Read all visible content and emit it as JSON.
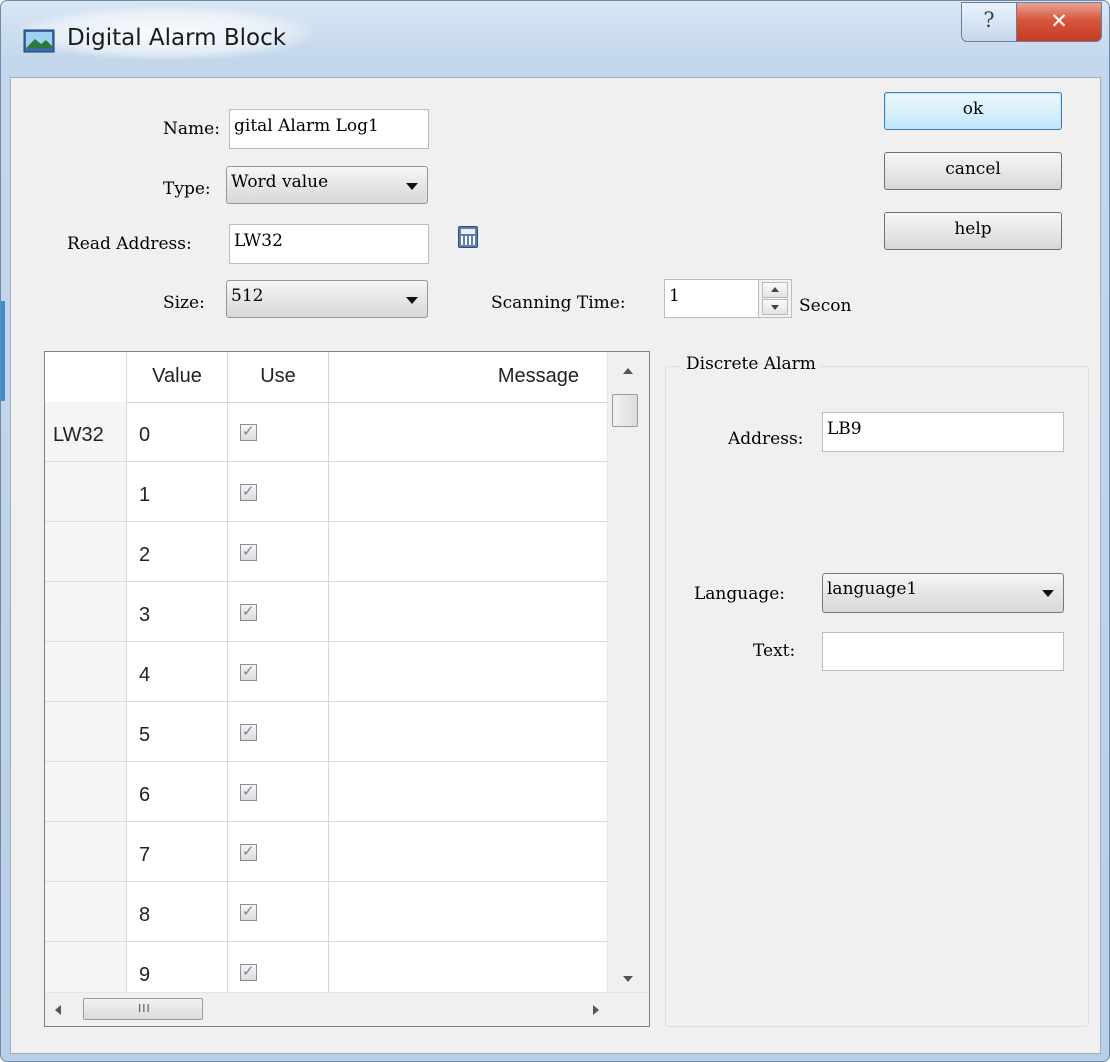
{
  "window": {
    "title": "Digital Alarm Block",
    "help_glyph": "?",
    "close_glyph": "✕"
  },
  "form": {
    "name_label": "Name:",
    "name_value": "gital Alarm Log1",
    "type_label": "Type:",
    "type_value": "Word value",
    "read_address_label": "Read Address:",
    "read_address_value": "LW32",
    "size_label": "Size:",
    "size_value": "512",
    "scanning_time_label": "Scanning Time:",
    "scanning_time_value": "1",
    "scanning_time_unit": "Secon"
  },
  "buttons": {
    "ok": "ok",
    "cancel": "cancel",
    "help": "help"
  },
  "table": {
    "columns": [
      "Value",
      "Use",
      "Message"
    ],
    "rows": [
      {
        "header": "LW32",
        "value": "0",
        "use": true,
        "message": ""
      },
      {
        "header": "",
        "value": "1",
        "use": true,
        "message": ""
      },
      {
        "header": "",
        "value": "2",
        "use": true,
        "message": ""
      },
      {
        "header": "",
        "value": "3",
        "use": true,
        "message": ""
      },
      {
        "header": "",
        "value": "4",
        "use": true,
        "message": ""
      },
      {
        "header": "",
        "value": "5",
        "use": true,
        "message": ""
      },
      {
        "header": "",
        "value": "6",
        "use": true,
        "message": ""
      },
      {
        "header": "",
        "value": "7",
        "use": true,
        "message": ""
      },
      {
        "header": "",
        "value": "8",
        "use": true,
        "message": ""
      },
      {
        "header": "",
        "value": "9",
        "use": true,
        "message": ""
      }
    ],
    "hscroll_grip": "III"
  },
  "discrete_alarm": {
    "group_title": "Discrete Alarm",
    "address_label": "Address:",
    "address_value": "LB9",
    "language_label": "Language:",
    "language_value": "language1",
    "text_label": "Text:",
    "text_value": ""
  },
  "colors": {
    "titlebar": "#c3d7ec",
    "close_button": "#d8553d",
    "client_bg": "#f0f0f0"
  }
}
